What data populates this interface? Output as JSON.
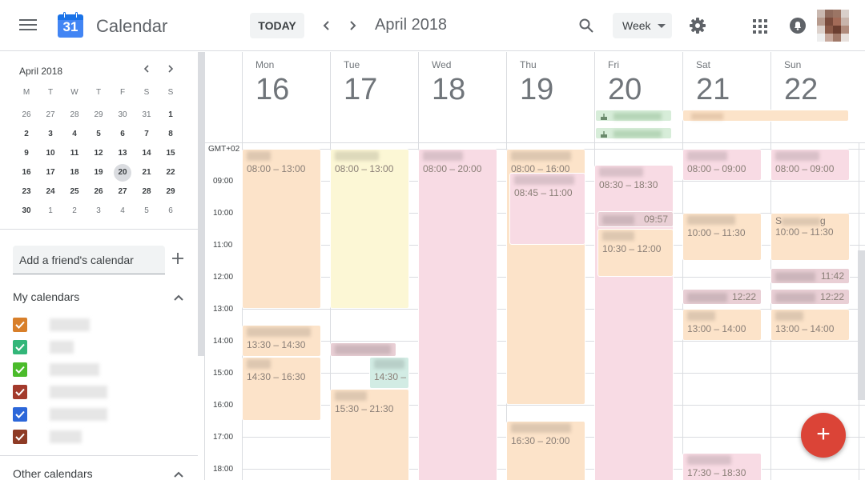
{
  "header": {
    "app_title": "Calendar",
    "logo_number": "31",
    "today_label": "TODAY",
    "prev_label": "‹",
    "next_label": "›",
    "period": "April 2018",
    "view": "Week"
  },
  "sidebar": {
    "mini_title": "April 2018",
    "weekday_heads": [
      "M",
      "T",
      "W",
      "T",
      "F",
      "S",
      "S"
    ],
    "weeks": [
      [
        "26",
        "27",
        "28",
        "29",
        "30",
        "31",
        "1"
      ],
      [
        "2",
        "3",
        "4",
        "5",
        "6",
        "7",
        "8"
      ],
      [
        "9",
        "10",
        "11",
        "12",
        "13",
        "14",
        "15"
      ],
      [
        "16",
        "17",
        "18",
        "19",
        "20",
        "21",
        "22"
      ],
      [
        "23",
        "24",
        "25",
        "26",
        "27",
        "28",
        "29"
      ],
      [
        "30",
        "1",
        "2",
        "3",
        "4",
        "5",
        "6"
      ]
    ],
    "today": "20",
    "friend_placeholder": "Add a friend's calendar",
    "my_calendars_title": "My calendars",
    "other_calendars_title": "Other calendars",
    "calendar_colors": [
      "#d87f2a",
      "#33b679",
      "#4bbb2b",
      "#a33a2c",
      "#2c67d9",
      "#8e3b25"
    ]
  },
  "week": {
    "timezone": "GMT+02",
    "days": [
      {
        "dow": "Mon",
        "num": "16"
      },
      {
        "dow": "Tue",
        "num": "17"
      },
      {
        "dow": "Wed",
        "num": "18"
      },
      {
        "dow": "Thu",
        "num": "19"
      },
      {
        "dow": "Fri",
        "num": "20"
      },
      {
        "dow": "Sat",
        "num": "21"
      },
      {
        "dow": "Sun",
        "num": "22"
      }
    ],
    "hours": [
      "09:00",
      "10:00",
      "11:00",
      "12:00",
      "13:00",
      "14:00",
      "15:00",
      "16:00",
      "17:00",
      "18:00"
    ]
  },
  "events": [
    {
      "time": "08:00 – 13:00"
    },
    {
      "time": "13:30 – 14:30"
    },
    {
      "time": "14:30 – 16:30"
    },
    {
      "time": "08:00 – 13:00"
    },
    {
      "time": "14:30 –"
    },
    {
      "time": "15:30 – 21:30"
    },
    {
      "time": "08:00 – 20:00"
    },
    {
      "time": "08:00 – 16:00"
    },
    {
      "time": "08:45 – 11:00"
    },
    {
      "time": "16:30 – 20:00"
    },
    {
      "time": "08:30 – 18:30"
    },
    {
      "time": "09:57"
    },
    {
      "time": "10:30 – 12:00"
    },
    {
      "time": "08:00 – 09:00"
    },
    {
      "time": "10:00 – 11:30"
    },
    {
      "time": "12:22"
    },
    {
      "time": "13:00 – 14:00"
    },
    {
      "time": "17:30 – 18:30"
    },
    {
      "time": "08:00 – 09:00"
    },
    {
      "time": "S",
      "time2": "g"
    },
    {
      "time": "10:00 – 11:30"
    },
    {
      "time": "11:42"
    },
    {
      "time": "12:22"
    },
    {
      "time": "13:00 – 14:00"
    }
  ],
  "fab_label": "+"
}
